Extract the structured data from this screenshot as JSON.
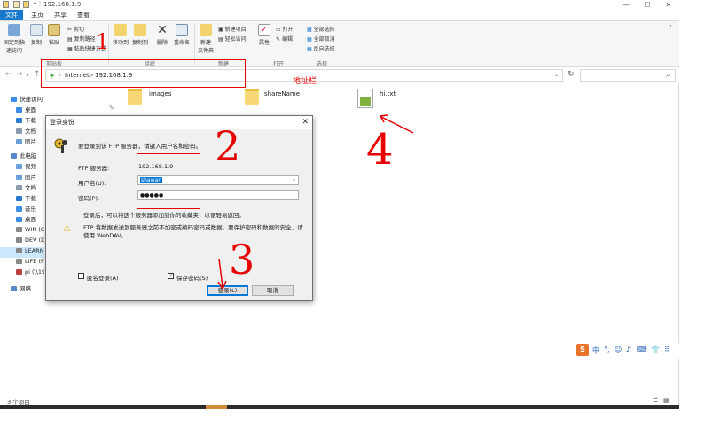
{
  "window": {
    "title": "192.168.1.9",
    "controls": [
      "—",
      "☐",
      "✕"
    ]
  },
  "tabs": [
    "文件",
    "主页",
    "共享",
    "查看"
  ],
  "ribbon": {
    "clipboard": {
      "pin": "固定到快\n速访问",
      "copy": "复制",
      "paste": "粘贴",
      "cut": "剪切",
      "copy_path": "复制路径",
      "paste_shortcut": "粘贴快捷方式",
      "label": "剪贴板"
    },
    "organize": {
      "move_to": "移动到",
      "copy_to": "复制到",
      "delete": "删除",
      "rename": "重命名",
      "label": "组织"
    },
    "new": {
      "new_item": "新建项目",
      "easy_access": "轻松访问",
      "new_folder": "新建\n文件夹",
      "label": "新建"
    },
    "open": {
      "properties": "属性",
      "open": "打开",
      "edit": "编辑",
      "label": "打开"
    },
    "select": {
      "select_all": "全部选择",
      "select_none": "全部取消",
      "invert": "反向选择",
      "label": "选择"
    }
  },
  "address": {
    "crumbs": [
      "Internet",
      ">",
      "192.168.1.9"
    ],
    "search_placeholder": ""
  },
  "nav_items": [
    {
      "label": "快速访问",
      "color": "#3a8ee6"
    },
    {
      "label": "桌面",
      "color": "#3a8ee6"
    },
    {
      "label": "下载",
      "color": "#2d7bd1"
    },
    {
      "label": "文档",
      "color": "#8a9bb0"
    },
    {
      "label": "图片",
      "color": "#6aa0d8"
    },
    {
      "label": "此电脑",
      "color": "#5a88c8"
    },
    {
      "label": "视频",
      "color": "#6aa0d8"
    },
    {
      "label": "图片",
      "color": "#6aa0d8"
    },
    {
      "label": "文档",
      "color": "#8a9bb0"
    },
    {
      "label": "下载",
      "color": "#2d7bd1"
    },
    {
      "label": "音乐",
      "color": "#3a8ee6"
    },
    {
      "label": "桌面",
      "color": "#3a8ee6"
    },
    {
      "label": "WIN (C:)",
      "color": "#888888"
    },
    {
      "label": "DEV (D:)",
      "color": "#888888"
    },
    {
      "label": "LEARN (",
      "color": "#888888"
    },
    {
      "label": "LIFE (F:)",
      "color": "#888888"
    },
    {
      "label": "pi (\\\\192",
      "color": "#c04040"
    },
    {
      "label": "网络",
      "color": "#5a88c8"
    }
  ],
  "files": [
    {
      "name": "images",
      "type": "folder"
    },
    {
      "name": "shareName",
      "type": "folder"
    },
    {
      "name": "hi.txt",
      "type": "file"
    }
  ],
  "status": "3 个项目",
  "dialog": {
    "title": "登录身份",
    "prompt": "要登录到该 FTP 服务器，请键入用户名和密码。",
    "server_label": "FTP 服务器:",
    "server_value": "192.168.1.9",
    "user_label": "用户名(U):",
    "user_value": "shawan",
    "pass_label": "密码(P):",
    "pass_value": "●●●●●",
    "note": "登录后，可以将这个服务器添加到你的收藏夹，以便轻易返回。",
    "warning": "FTP 将数据发送到服务器之前不加密或编码密码或数据。要保护密码和数据的安全，请使用 WebDAV。",
    "anon_label": "匿名登录(A)",
    "save_label": "保存密码(S)",
    "login_btn": "登录(L)",
    "cancel_btn": "取消"
  },
  "annotations": {
    "n1": "1",
    "addr": "地址栏",
    "n2": "2",
    "n3": "3",
    "n4": "4"
  },
  "ime": {
    "logo": "S",
    "items": [
      "中",
      "°,",
      "☺",
      "♪",
      "⌨",
      "👕",
      "⠿"
    ]
  }
}
